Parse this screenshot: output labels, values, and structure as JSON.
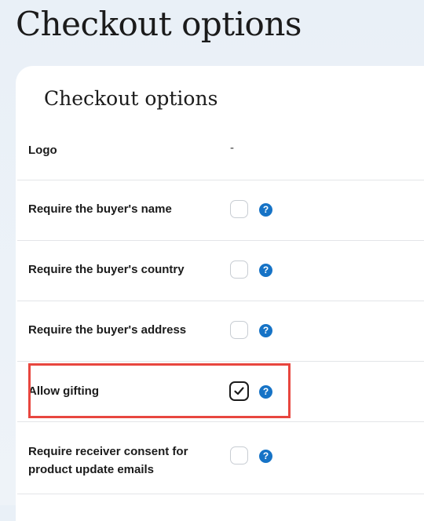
{
  "page": {
    "title": "Checkout options"
  },
  "card": {
    "title": "Checkout options",
    "rows": [
      {
        "label": "Logo",
        "value": "-"
      },
      {
        "label": "Require the buyer's name",
        "checked": false,
        "help": "?"
      },
      {
        "label": "Require the buyer's country",
        "checked": false,
        "help": "?"
      },
      {
        "label": "Require the buyer's address",
        "checked": false,
        "help": "?"
      },
      {
        "label": "Allow gifting",
        "checked": true,
        "help": "?"
      },
      {
        "label": "Require receiver consent for product update emails",
        "checked": false,
        "help": "?"
      }
    ]
  },
  "colors": {
    "accent": "#1673c6",
    "highlight": "#e8463f",
    "background": "#e9f0f7"
  }
}
